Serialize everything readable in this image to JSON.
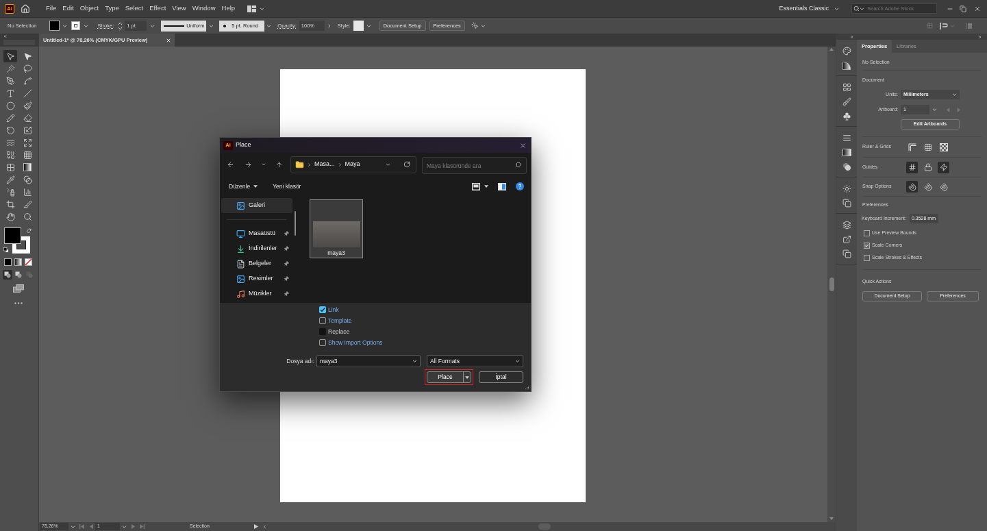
{
  "menu_bar": {
    "logo": "Ai",
    "menus": [
      "File",
      "Edit",
      "Object",
      "Type",
      "Select",
      "Effect",
      "View",
      "Window",
      "Help"
    ],
    "workspace": "Essentials Classic",
    "search": {
      "placeholder": "Search Adobe Stock"
    }
  },
  "control_bar": {
    "selection": "No Selection",
    "stroke_label": "Stroke:",
    "stroke_weight": "1 pt",
    "stroke_profile": "Uniform",
    "brush": "5 pt. Round",
    "opacity_label": "Opacity:",
    "opacity": "100%",
    "style_label": "Style:",
    "buttons": [
      "Document Setup",
      "Preferences"
    ]
  },
  "document_tab": {
    "title": "Untitled-1* @ 78,26% (CMYK/GPU Preview)"
  },
  "tools_panel": {
    "tools": [
      {
        "kind": "selection",
        "selected": true
      },
      {
        "kind": "direct_selection",
        "selected": false
      },
      {
        "kind": "magic_wand",
        "selected": false
      },
      {
        "kind": "lasso",
        "selected": false
      },
      {
        "kind": "pen",
        "selected": false
      },
      {
        "kind": "curvature",
        "selected": false
      },
      {
        "kind": "type",
        "selected": false
      },
      {
        "kind": "line",
        "selected": false
      },
      {
        "kind": "ellipse",
        "selected": false
      },
      {
        "kind": "paintbrush",
        "selected": false
      },
      {
        "kind": "shaper",
        "selected": false
      },
      {
        "kind": "eraser",
        "selected": false
      },
      {
        "kind": "rotate",
        "selected": false
      },
      {
        "kind": "scale",
        "selected": false
      },
      {
        "kind": "warp",
        "selected": false
      },
      {
        "kind": "free_transform",
        "selected": false
      },
      {
        "kind": "shape_builder",
        "selected": false
      },
      {
        "kind": "perspective_grid",
        "selected": false
      },
      {
        "kind": "mesh",
        "selected": false
      },
      {
        "kind": "gradient",
        "selected": false
      },
      {
        "kind": "eyedropper",
        "selected": false
      },
      {
        "kind": "blend",
        "selected": false
      },
      {
        "kind": "symbol_sprayer",
        "selected": false
      },
      {
        "kind": "graph",
        "selected": false
      },
      {
        "kind": "artboard",
        "selected": false
      },
      {
        "kind": "slice",
        "selected": false
      },
      {
        "kind": "hand",
        "selected": false
      },
      {
        "kind": "zoom",
        "selected": false
      }
    ],
    "draw_modes": [
      {
        "selected": true,
        "disabled": false
      },
      {
        "selected": false,
        "disabled": false
      },
      {
        "selected": false,
        "disabled": true
      }
    ]
  },
  "properties": {
    "tabs": [
      {
        "label": "Properties",
        "selected": true
      },
      {
        "label": "Libraries",
        "selected": false
      }
    ],
    "selection": "No Selection",
    "document": {
      "heading": "Document",
      "units_label": "Units:",
      "units": "Millimeters",
      "artboard_label": "Artboard:",
      "artboard": "1",
      "button": "Edit Artboards"
    },
    "toggle_rows": [
      {
        "label": "Ruler & Grids",
        "toggles": [
          {
            "kind": "rulers",
            "selected": false
          },
          {
            "kind": "grid",
            "selected": false
          },
          {
            "kind": "transparency_grid",
            "selected": false
          }
        ]
      },
      {
        "label": "Guides",
        "toggles": [
          {
            "kind": "guides",
            "selected": true
          },
          {
            "kind": "lock_guides",
            "selected": false
          },
          {
            "kind": "smart_guides",
            "selected": true
          }
        ]
      },
      {
        "label": "Snap Options",
        "toggles": [
          {
            "kind": "snap_point",
            "selected": true
          },
          {
            "kind": "snap_pixel",
            "selected": false
          },
          {
            "kind": "snap_glyph",
            "selected": false
          }
        ]
      }
    ],
    "preferences": {
      "heading": "Preferences",
      "increment_label": "Keyboard Increment:",
      "increment": "0.3528 mm",
      "checkboxes": [
        {
          "label": "Use Preview Bounds",
          "checked": false
        },
        {
          "label": "Scale Corners",
          "checked": true
        },
        {
          "label": "Scale Strokes & Effects",
          "checked": false
        }
      ]
    },
    "quick_actions": {
      "heading": "Quick Actions",
      "buttons": [
        "Document Setup",
        "Preferences"
      ]
    }
  },
  "dialog": {
    "logo": "Ai",
    "title": "Place",
    "path": [
      "Masa...",
      "Maya"
    ],
    "search": {
      "placeholder": "Maya klasöründe ara"
    },
    "commands": [
      {
        "label": "Düzenle",
        "kind": "menu"
      },
      {
        "label": "Yeni klasör",
        "kind": "button"
      }
    ],
    "nav_groups": [
      {
        "items": [
          {
            "label": "Galeri",
            "kind": "gallery",
            "selected": true,
            "pinned": false
          }
        ]
      },
      {
        "items": [
          {
            "label": "Masaüstü",
            "kind": "desktop",
            "selected": false,
            "pinned": true
          },
          {
            "label": "İndirilenler",
            "kind": "downloads",
            "selected": false,
            "pinned": true
          },
          {
            "label": "Belgeler",
            "kind": "documents",
            "selected": false,
            "pinned": true
          },
          {
            "label": "Resimler",
            "kind": "pictures",
            "selected": false,
            "pinned": true
          },
          {
            "label": "Müzikler",
            "kind": "music",
            "selected": false,
            "pinned": true
          }
        ]
      }
    ],
    "files": [
      {
        "name": "maya3",
        "selected": true
      }
    ],
    "options": [
      {
        "label": "Link",
        "checked": true,
        "disabled": false
      },
      {
        "label": "Template",
        "checked": false,
        "disabled": false
      },
      {
        "label": "Replace",
        "checked": false,
        "disabled": true
      },
      {
        "label": "Show Import Options",
        "checked": false,
        "disabled": false
      }
    ],
    "filename_label": "Dosya adı:",
    "filename": "maya3",
    "format": "All Formats",
    "place_button": {
      "label": "Place",
      "highlighted": true
    },
    "cancel_button": "İptal"
  },
  "status_bar": {
    "zoom": "78,26%",
    "artboard": "1",
    "tool": "Selection"
  }
}
